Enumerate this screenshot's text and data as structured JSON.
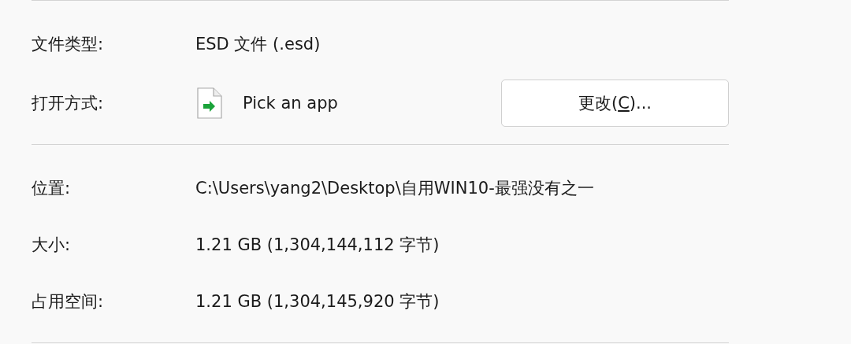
{
  "sections": [
    {
      "rows": [
        {
          "kind": "text",
          "label": "文件类型:",
          "value": "ESD 文件 (.esd)"
        },
        {
          "kind": "app",
          "label": "打开方式:",
          "value": "Pick an app",
          "button": {
            "before": "更改(",
            "access_key": "C",
            "after": ")..."
          }
        }
      ]
    },
    {
      "rows": [
        {
          "kind": "text",
          "label": "位置:",
          "value": "C:\\Users\\yang2\\Desktop\\自用WIN10-最强没有之一"
        },
        {
          "kind": "text",
          "label": "大小:",
          "value": "1.21 GB (1,304,144,112 字节)"
        },
        {
          "kind": "text",
          "label": "占用空间:",
          "value": "1.21 GB (1,304,145,920 字节)"
        }
      ]
    }
  ]
}
